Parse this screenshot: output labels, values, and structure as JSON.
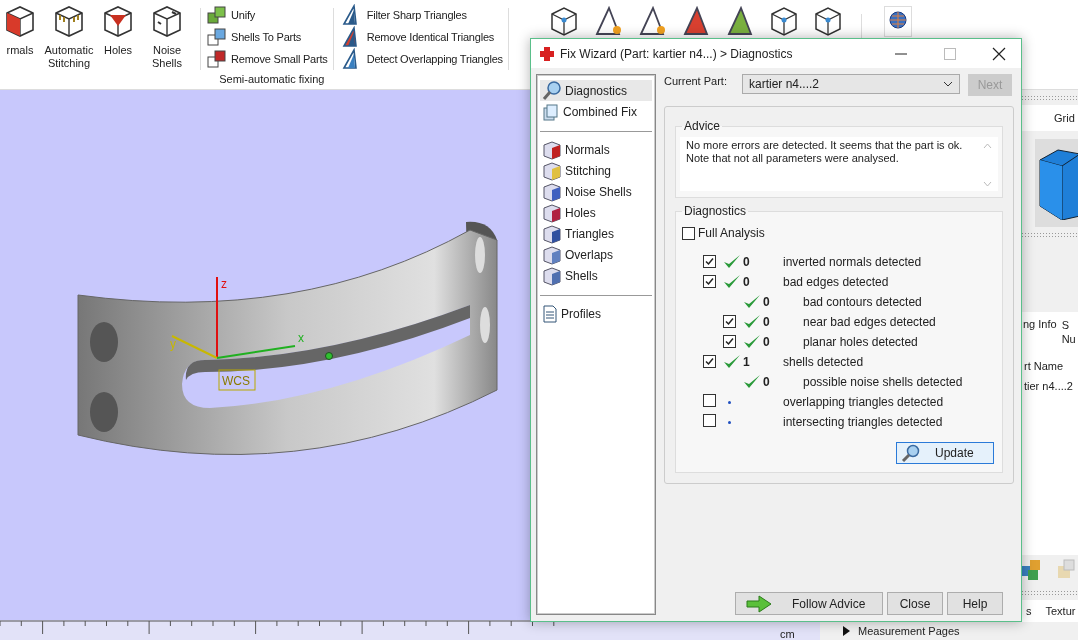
{
  "ribbon": {
    "big_buttons": [
      {
        "label": "rmals"
      },
      {
        "label": "Automatic Stitching"
      },
      {
        "label": "Holes"
      },
      {
        "label": "Noise Shells"
      }
    ],
    "semi_auto": {
      "items": [
        "Unify",
        "Shells To Parts",
        "Remove Small Parts"
      ],
      "group_label": "Semi-automatic fixing"
    },
    "triangle_tools": [
      "Filter Sharp Triangles",
      "Remove Identical Triangles",
      "Detect Overlapping Triangles"
    ]
  },
  "viewport": {
    "axes": [
      {
        "label": "z"
      },
      {
        "label": "y"
      },
      {
        "label": "x"
      }
    ],
    "frame_label": "WCS",
    "ruler_unit": "cm"
  },
  "right_panel": {
    "top_tabs": [
      "Grid"
    ],
    "info_tabs": [
      "ng Info"
    ],
    "info_column_lines": [
      "S",
      "Nu"
    ],
    "table": {
      "header": "rt Name",
      "rows": [
        "tier n4....2"
      ]
    },
    "bottom_tabs": [
      "s",
      "Textur"
    ],
    "section": {
      "label": "Measurement Pages",
      "expanded": false
    }
  },
  "dialog": {
    "title": "Fix Wizard (Part: kartier n4...) > Diagnostics",
    "sidebar": {
      "groups": [
        [
          {
            "label": "Diagnostics",
            "selected": true
          },
          {
            "label": "Combined Fix",
            "selected": false
          }
        ],
        [
          {
            "label": "Normals",
            "selected": false
          },
          {
            "label": "Stitching",
            "selected": false
          },
          {
            "label": "Noise Shells",
            "selected": false
          },
          {
            "label": "Holes",
            "selected": false
          },
          {
            "label": "Triangles",
            "selected": false
          },
          {
            "label": "Overlaps",
            "selected": false
          },
          {
            "label": "Shells",
            "selected": false
          }
        ],
        [
          {
            "label": "Profiles",
            "selected": false
          }
        ]
      ]
    },
    "current_part": {
      "label": "Current Part:",
      "value": "kartier n4....2"
    },
    "next_button": {
      "label": "Next",
      "disabled": true
    },
    "advice": {
      "title": "Advice",
      "text": "No more errors are detected. It seems that the part is ok.\nNote that not all parameters were analysed."
    },
    "diagnostics": {
      "title": "Diagnostics",
      "full_analysis": {
        "label": "Full Analysis",
        "checked": false
      },
      "checks": [
        {
          "kind": "checkbox",
          "checked": true,
          "ok": true,
          "count": "0",
          "label": "inverted normals detected"
        },
        {
          "kind": "checkbox",
          "checked": true,
          "ok": true,
          "count": "0",
          "label": "bad edges detected",
          "children": [
            {
              "kind": "plain",
              "ok": true,
              "count": "0",
              "label": "bad contours detected"
            },
            {
              "kind": "checkbox",
              "checked": true,
              "ok": true,
              "count": "0",
              "label": "near bad edges detected"
            },
            {
              "kind": "checkbox",
              "checked": true,
              "ok": true,
              "count": "0",
              "label": "planar holes detected"
            }
          ]
        },
        {
          "kind": "checkbox",
          "checked": true,
          "ok": true,
          "count": "1",
          "label": "shells detected",
          "children": [
            {
              "kind": "plain",
              "ok": true,
              "count": "0",
              "label": "possible noise shells detected"
            }
          ]
        },
        {
          "kind": "checkbox",
          "checked": false,
          "ok": false,
          "label": "overlapping triangles detected"
        },
        {
          "kind": "checkbox",
          "checked": false,
          "ok": false,
          "label": "intersecting triangles detected"
        }
      ],
      "update_button": "Update"
    },
    "buttons": [
      {
        "label": "Follow Advice",
        "kind": "follow"
      },
      {
        "label": "Close",
        "kind": "plain"
      },
      {
        "label": "Help",
        "kind": "plain"
      }
    ]
  }
}
